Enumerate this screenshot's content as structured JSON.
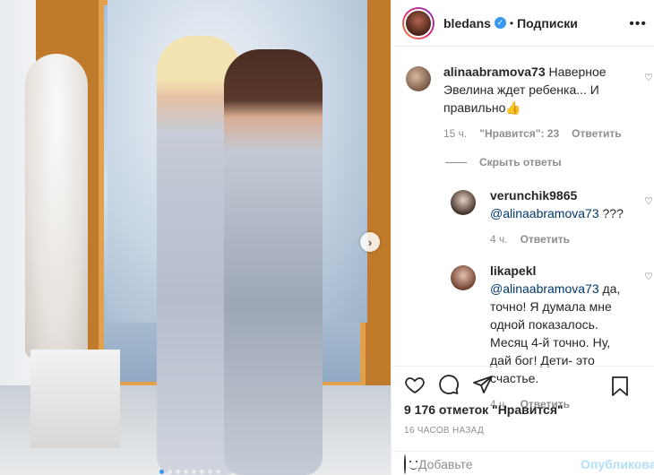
{
  "header": {
    "username": "bledans",
    "separator": "•",
    "follow_label": "Подписки",
    "more_label": "•••"
  },
  "post": {
    "dots_count": 8,
    "active_dot": 0
  },
  "comments": [
    {
      "user": "alinaabramova73",
      "text": "Наверное Эвелина ждет ребенка... И правильно👍",
      "time": "15 ч.",
      "likes": "\"Нравится\": 23",
      "reply_label": "Ответить"
    }
  ],
  "hide_replies_label": "Скрыть ответы",
  "replies": [
    {
      "user": "verunchik9865",
      "mention": "@alinaabramova73",
      "text": " ???",
      "time": "4 ч.",
      "reply_label": "Ответить"
    },
    {
      "user": "likapekl",
      "mention": "@alinaabramova73",
      "text": " да, точно! Я думала мне одной показалось. Месяц 4-й точно. Ну, дай бог! Дети- это счастье.",
      "time": "4 ч.",
      "reply_label": "Ответить"
    }
  ],
  "actions": {
    "likes_text": "9 176 отметок \"Нравится\"",
    "time_ago": "16 ЧАСОВ НАЗАД"
  },
  "add_comment": {
    "placeholder": "Добавьте",
    "publish_label": "Опубликовать"
  },
  "colors": {
    "accent": "#3897f0",
    "mention": "#00376b",
    "muted": "#8e8e8e",
    "publish_disabled": "#b2dffc"
  }
}
